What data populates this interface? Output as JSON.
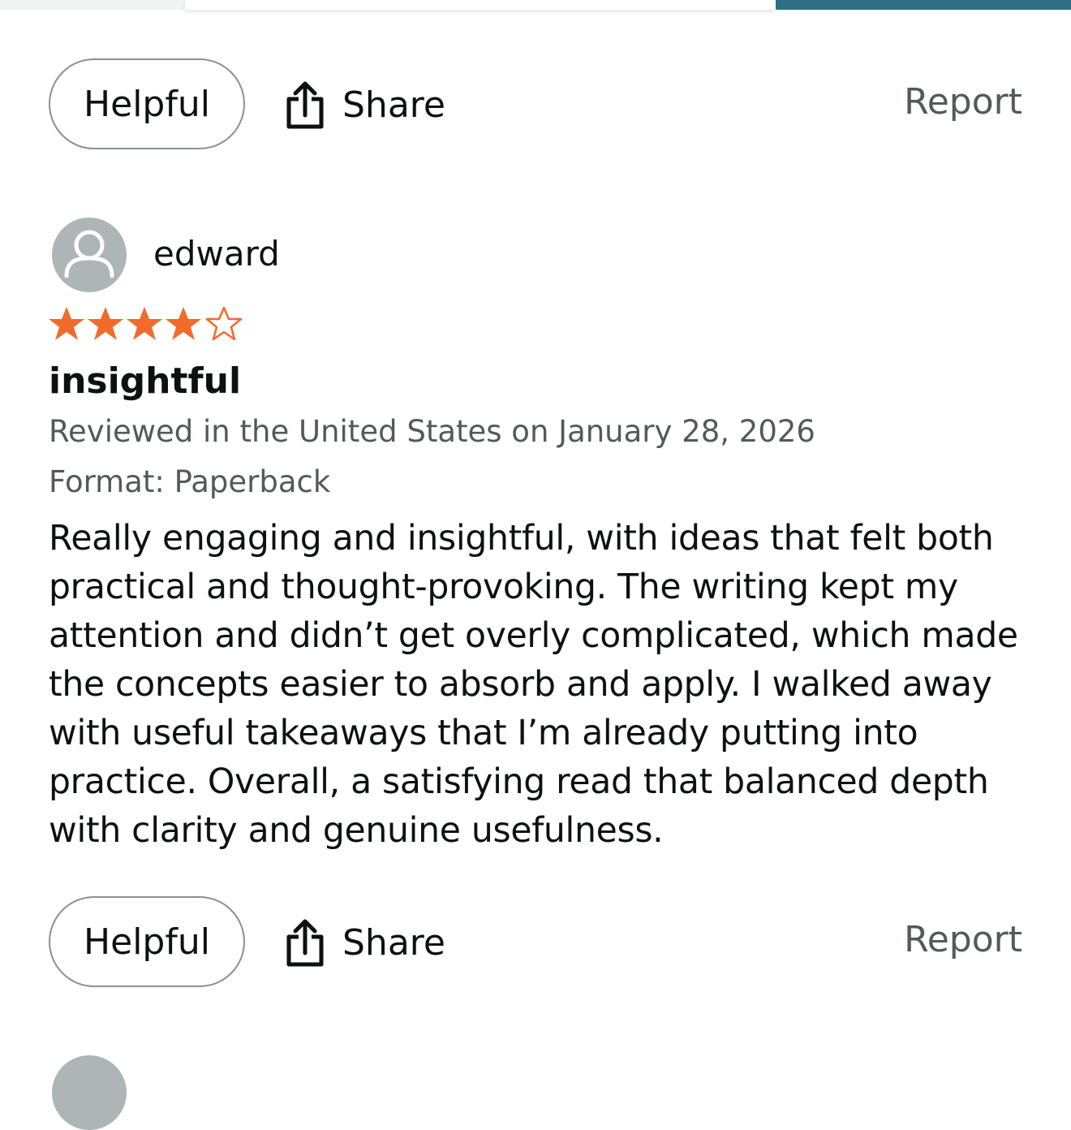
{
  "top_review_actions": {
    "helpful_label": "Helpful",
    "share_label": "Share",
    "report_label": "Report"
  },
  "review": {
    "reviewer_name": "edward",
    "rating": 4,
    "rating_max": 5,
    "title": "insightful",
    "meta": "Reviewed in the United States on January 28, 2026",
    "format": "Format: Paperback",
    "body": "Really engaging and insightful, with ideas that felt both practical and thought-provoking. The writing kept my attention and didn’t get overly complicated, which made the concepts easier to absorb and apply. I walked away with useful takeaways that I’m already putting into practice. Overall, a satisfying read that balanced depth with clarity and genuine usefulness.",
    "helpful_label": "Helpful",
    "share_label": "Share",
    "report_label": "Report"
  },
  "icons": {
    "share": "share-icon",
    "avatar": "user-avatar-icon",
    "star": "star-icon"
  },
  "colors": {
    "star_fill": "#f06b2c",
    "muted_text": "#565959",
    "avatar_bg": "#adb5b7",
    "header_accent": "#2f6f86"
  }
}
